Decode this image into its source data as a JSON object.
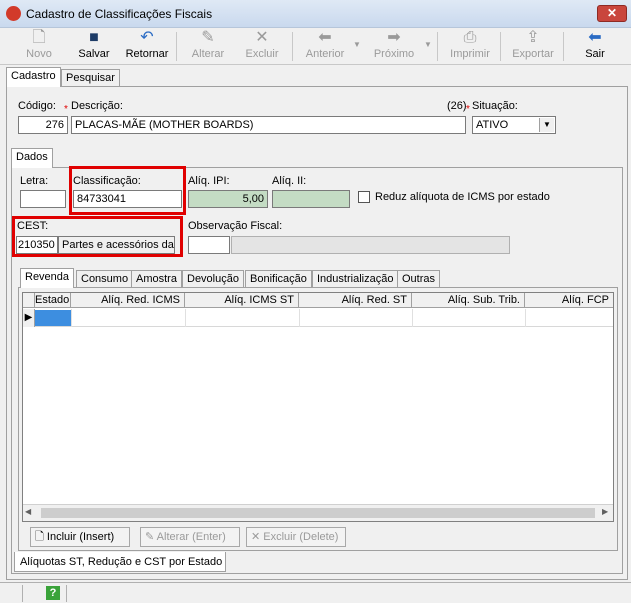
{
  "window": {
    "title": "Cadastro de Classificações Fiscais",
    "close": "✕"
  },
  "toolbar": {
    "novo": "Novo",
    "salvar": "Salvar",
    "retornar": "Retornar",
    "alterar": "Alterar",
    "excluir": "Excluir",
    "anterior": "Anterior",
    "proximo": "Próximo",
    "imprimir": "Imprimir",
    "exportar": "Exportar",
    "sair": "Sair"
  },
  "main_tabs": [
    "Cadastro",
    "Pesquisar"
  ],
  "form": {
    "codigo_label": "Código:",
    "codigo": "276",
    "descricao_label": "Descrição:",
    "descricao": "PLACAS-MÃE (MOTHER BOARDS)",
    "char_count": "(26)",
    "situacao_label": "Situação:",
    "situacao": "ATIVO"
  },
  "dados_tab": "Dados",
  "dados": {
    "letra_label": "Letra:",
    "letra": "",
    "classificacao_label": "Classificação:",
    "classificacao": "84733041",
    "aliq_ipi_label": "Alíq. IPI:",
    "aliq_ipi": "5,00",
    "aliq_ii_label": "Alíq. II:",
    "aliq_ii": "",
    "reduz_label": "Reduz alíquota de ICMS por estado",
    "cest_label": "CEST:",
    "cest_code": "210350",
    "cest_desc": "Partes e acessórios das",
    "obs_label": "Observação Fiscal:",
    "obs_code": "",
    "obs_text": ""
  },
  "sub_tabs": [
    "Revenda",
    "Consumo",
    "Amostra",
    "Devolução",
    "Bonificação",
    "Industrialização",
    "Outras"
  ],
  "grid_columns": [
    "Estado",
    "Alíq. Red. ICMS",
    "Alíq. ICMS ST",
    "Alíq. Red. ST",
    "Alíq. Sub. Trib.",
    "Alíq. FCP"
  ],
  "actions": {
    "incluir": "Incluir (Insert)",
    "alterar": "Alterar (Enter)",
    "excluir": "Excluir (Delete)"
  },
  "bottom_tab": "Alíquotas ST, Redução e CST por Estado",
  "status": {
    "help": "?"
  }
}
